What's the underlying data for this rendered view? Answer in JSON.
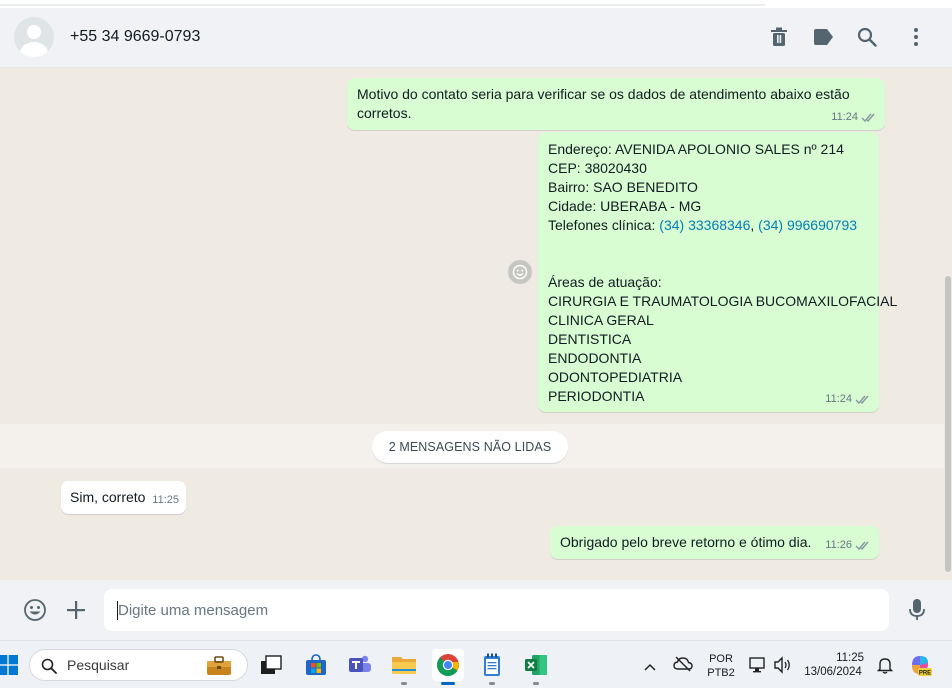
{
  "header": {
    "contact_name": "+55 34 9669-0793",
    "icons": [
      "trash-icon",
      "label-icon",
      "search-icon",
      "kebab-menu-icon"
    ]
  },
  "messages": [
    {
      "direction": "outgoing",
      "lines": [
        "Motivo do contato seria para verificar se os dados de atendimento abaixo estão",
        "corretos."
      ],
      "time": "11:24",
      "status": "read"
    },
    {
      "direction": "outgoing",
      "lines": [
        "Endereço: AVENIDA APOLONIO SALES nº 214",
        "CEP: 38020430",
        "Bairro: SAO BENEDITO",
        "Cidade: UBERABA - MG",
        "",
        "",
        "",
        "Áreas de atuação:",
        "CIRURGIA E TRAUMATOLOGIA BUCOMAXILOFACIAL",
        "CLINICA GERAL",
        "DENTISTICA",
        "ENDODONTIA",
        "ODONTOPEDIATRIA",
        "PERIODONTIA"
      ],
      "phones_label": "Telefones clínica: ",
      "phone_1": "(34) 33368346",
      "phone_sep": ", ",
      "phone_2": "(34) 996690793",
      "time": "11:24",
      "status": "read"
    },
    {
      "direction": "incoming",
      "text": "Sim, correto",
      "time": "11:25"
    },
    {
      "direction": "outgoing",
      "text": "Obrigado pelo breve retorno e ótimo dia.",
      "time": "11:26",
      "status": "read"
    }
  ],
  "unread_divider": "2 MENSAGENS NÃO LIDAS",
  "composer": {
    "placeholder": "Digite uma mensagem",
    "value": ""
  },
  "taskbar": {
    "search_placeholder": "Pesquisar",
    "language_line1": "POR",
    "language_line2": "PTB2",
    "time": "11:25",
    "date": "13/06/2024",
    "apps": [
      "windows-start-icon",
      "briefcase-icon",
      "task-view-icon",
      "microsoft-store-icon",
      "teams-icon",
      "file-explorer-icon",
      "chrome-icon",
      "notepad-icon",
      "excel-icon"
    ]
  },
  "colors": {
    "outgoing_bubble": "#d9fdd3",
    "incoming_bubble": "#ffffff",
    "chat_background": "#efeae2",
    "header_background": "#f0f2f5",
    "link": "#027eb5",
    "read_ticks": "#8696a0"
  }
}
